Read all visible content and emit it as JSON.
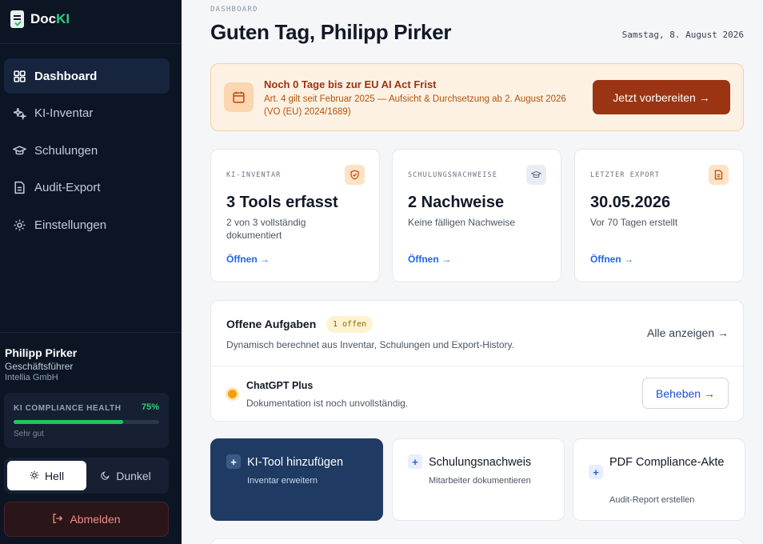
{
  "brand": {
    "prefix": "Doc",
    "accent": "KI"
  },
  "sidebar": {
    "items": [
      {
        "label": "Dashboard",
        "icon": "grid-icon",
        "active": true
      },
      {
        "label": "KI-Inventar",
        "icon": "sparkles-icon"
      },
      {
        "label": "Schulungen",
        "icon": "graduation-cap-icon"
      },
      {
        "label": "Audit-Export",
        "icon": "document-icon"
      },
      {
        "label": "Einstellungen",
        "icon": "gear-icon"
      }
    ],
    "user": {
      "name": "Philipp Pirker",
      "role": "Geschäftsführer",
      "company": "Intellia GmbH"
    },
    "health": {
      "label": "KI COMPLIANCE HEALTH",
      "percent_label": "75%",
      "percent": 75,
      "status": "Sehr gut"
    },
    "theme": {
      "light": "Hell",
      "dark": "Dunkel",
      "selected": "light"
    },
    "logout": "Abmelden"
  },
  "header": {
    "eyebrow": "DASHBOARD",
    "greeting": "Guten Tag, Philipp Pirker",
    "date": "Samstag, 8. August 2026"
  },
  "alert": {
    "title": "Noch 0 Tage bis zur EU AI Act Frist",
    "text": "Art. 4 gilt seit Februar 2025 — Aufsicht & Durchsetzung ab 2. August 2026 (VO (EU) 2024/1689)",
    "button": "Jetzt vorbereiten →"
  },
  "stats": [
    {
      "label": "KI-INVENTAR",
      "value": "3 Tools erfasst",
      "sub": "2 von 3 vollständig dokumentiert",
      "link": "Öffnen →",
      "icon": "shield-icon"
    },
    {
      "label": "SCHULUNGSNACHWEISE",
      "value": "2 Nachweise",
      "sub": "Keine fälligen Nachweise",
      "link": "Öffnen →",
      "icon": "graduation-cap-icon"
    },
    {
      "label": "LETZTER EXPORT",
      "value": "30.05.2026",
      "sub": "Vor 70 Tagen erstellt",
      "link": "Öffnen →",
      "icon": "document-icon"
    }
  ],
  "tasks": {
    "title": "Offene Aufgaben",
    "badge": "1 offen",
    "subtitle": "Dynamisch berechnet aus Inventar, Schulungen und Export-History.",
    "show_all": "Alle anzeigen →",
    "items": [
      {
        "name": "ChatGPT Plus",
        "desc": "Dokumentation ist noch unvollständig.",
        "button": "Beheben →"
      }
    ]
  },
  "actions": [
    {
      "title": "KI-Tool hinzufügen",
      "sub": "Inventar erweitern"
    },
    {
      "title": "Schulungsnachweis",
      "sub": "Mitarbeiter dokumentieren"
    },
    {
      "title": "PDF Compliance-Akte",
      "sub": "Audit-Report erstellen"
    }
  ],
  "colors": {
    "sidebar_bg": "#0c1524",
    "accent_green": "#22c55e",
    "alert_button": "#9a3412",
    "primary_action": "#1f3b63",
    "link_blue": "#2563eb"
  }
}
